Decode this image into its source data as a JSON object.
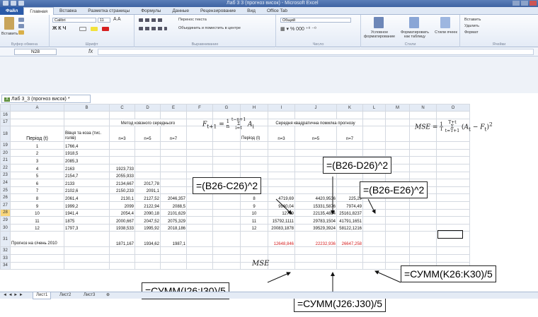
{
  "window": {
    "title": "Лаб 3 3 (прогноз висок) - Microsoft Excel"
  },
  "ribbon_tabs": [
    "Файл",
    "Главная",
    "Вставка",
    "Разметка страницы",
    "Формулы",
    "Данные",
    "Рецензирование",
    "Вид",
    "Office Tab"
  ],
  "ribbon": {
    "paste_label": "Вставить",
    "clipboard_group": "Буфер обмена",
    "font_name": "Calibri",
    "font_size": "11",
    "font_group": "Шрифт",
    "wrap_text": "Перенос текста",
    "merge_center": "Объединить и поместить в центре",
    "alignment_group": "Выравнивание",
    "number_format": "Общий",
    "number_group": "Число",
    "conditional_format": "Условное форматирование",
    "format_table": "Форматировать как таблицу",
    "cell_styles": "Стили ячеек",
    "styles_group": "Стили",
    "insert_cells": "Вставить",
    "delete_cells": "Удалить",
    "format_cells": "Формат",
    "cells_group": "Ячейки"
  },
  "formula_bar": {
    "name_box": "N28",
    "fx": "fx",
    "value": ""
  },
  "document_tab": {
    "icon": "X",
    "label": "Лаб 3_3 (прогноз висок) *"
  },
  "columns": [
    "A",
    "B",
    "C",
    "D",
    "E",
    "F",
    "G",
    "H",
    "I",
    "J",
    "K",
    "L",
    "M",
    "N",
    "O"
  ],
  "headers": {
    "moving_avg_method": "Метод ковзного середнього",
    "mse_method": "Середня квадратична помилка прогнозу",
    "period": "Період (t)",
    "sales": "Вівця та коза (тис. голів)",
    "period_h": "Період (t)",
    "n3": "n=3",
    "n5": "n=5",
    "n7": "n=7"
  },
  "rows": [
    {
      "r": "16"
    },
    {
      "r": "17"
    },
    {
      "r": "18"
    },
    {
      "r": "19",
      "a": "1",
      "b": "1766,4"
    },
    {
      "r": "20",
      "a": "2",
      "b": "1918,5"
    },
    {
      "r": "21",
      "a": "3",
      "b": "2085,3"
    },
    {
      "r": "22",
      "a": "4",
      "b": "2163",
      "c": "1923,733"
    },
    {
      "r": "23",
      "a": "5",
      "b": "2154,7",
      "c": "2055,933"
    },
    {
      "r": "24",
      "a": "6",
      "b": "2133",
      "c": "2134,667",
      "d": "2017,78"
    },
    {
      "r": "25",
      "a": "7",
      "b": "2102,6",
      "c": "2150,233",
      "d": "2091,1",
      "h": "7"
    },
    {
      "r": "26",
      "a": "8",
      "b": "2061,4",
      "c": "2130,1",
      "d": "2127,52",
      "e": "2046,357",
      "h": "8",
      "i": "4719,69",
      "j": "4420,9536",
      "k": "225,29"
    },
    {
      "r": "27",
      "a": "9",
      "b": "1999,2",
      "c": "2099",
      "d": "2122,94",
      "e": "2088,5",
      "h": "9",
      "i": "9960,04",
      "j": "15331,5876",
      "k": "7974,49"
    },
    {
      "r": "28",
      "a": "10",
      "b": "1941,4",
      "c": "2054,4",
      "d": "2090,18",
      "e": "2101,629",
      "h": "10",
      "i": "12769",
      "j": "22135,4884",
      "k": "25161,8237"
    },
    {
      "r": "29",
      "a": "11",
      "b": "1875",
      "c": "2000,667",
      "d": "2047,52",
      "e": "2075,329",
      "h": "11",
      "i": "15792,1111",
      "j": "29783,1504",
      "k": "41791,1651"
    },
    {
      "r": "30",
      "a": "12",
      "b": "1797,3",
      "c": "1938,533",
      "d": "1995,92",
      "e": "2018,186",
      "h": "12",
      "i": "20083,1878",
      "j": "39529,3924",
      "k": "58122,1216"
    },
    {
      "r": "31",
      "a": "Прогноз на січень 2010",
      "c": "1871,167",
      "d": "1934,62",
      "e": "1987,1",
      "i": "12648,846",
      "j": "22232,936",
      "k": "26647,258"
    },
    {
      "r": "32"
    },
    {
      "r": "33"
    },
    {
      "r": "34"
    }
  ],
  "mse_label": "MSE",
  "callouts": {
    "c1": "=(B26-C26)^2",
    "c2": "=(B26-D26)^2",
    "c3": "=(B26-E26)^2",
    "c4": "=СУММ(I26:I30)/5",
    "c5": "=СУММ(J26:J30)/5",
    "c6": "=СУММ(K26:K30)/5"
  },
  "sheets": [
    "Лист1",
    "Лист2",
    "Лист3"
  ],
  "colors": {
    "red": "#d62020",
    "selection": "#f9d67a"
  }
}
